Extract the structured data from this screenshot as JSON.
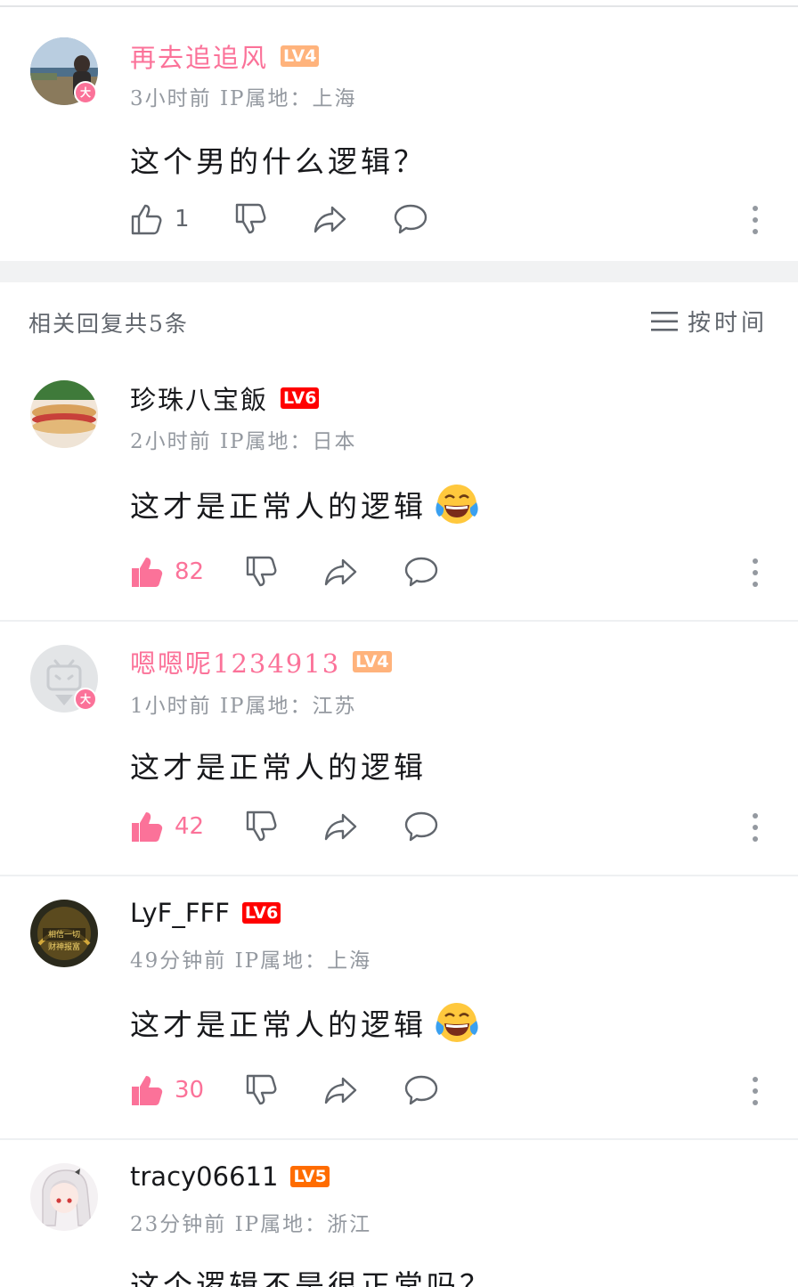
{
  "root_comment": {
    "username": "再去追追风",
    "level": "LV4",
    "vip_badge": "大",
    "meta": "3小时前 IP属地：上海",
    "content": "这个男的什么逻辑？",
    "likes": "1"
  },
  "replies_header": {
    "count_label": "相关回复共5条",
    "sort_label": "按时间"
  },
  "replies": [
    {
      "username": "珍珠八宝飯",
      "level": "LV6",
      "meta": "2小时前 IP属地：日本",
      "content": "这才是正常人的逻辑",
      "likes": "82"
    },
    {
      "username": "嗯嗯呢1234913",
      "level": "LV4",
      "vip_badge": "大",
      "meta": "1小时前 IP属地：江苏",
      "content": "这才是正常人的逻辑",
      "likes": "42"
    },
    {
      "username": "LyF_FFF",
      "level": "LV6",
      "meta": "49分钟前 IP属地：上海",
      "content": "这才是正常人的逻辑",
      "likes": "30",
      "avatar_text": [
        "相信一切",
        "财神报富"
      ]
    },
    {
      "username": "tracy06611",
      "level": "LV5",
      "meta": "23分钟前 IP属地：浙江",
      "content": "这个逻辑不是很正常吗？"
    }
  ],
  "colors": {
    "vip_pink": "#fb7299",
    "lv4": "#ffb37c",
    "lv5": "#ff6c00",
    "lv6": "#ff0000",
    "text_secondary": "#9499a0",
    "icon": "#61666d"
  },
  "icons": [
    "like-icon",
    "dislike-icon",
    "share-icon",
    "reply-icon",
    "more-icon",
    "sort-icon",
    "laugh-cry-emoji"
  ]
}
